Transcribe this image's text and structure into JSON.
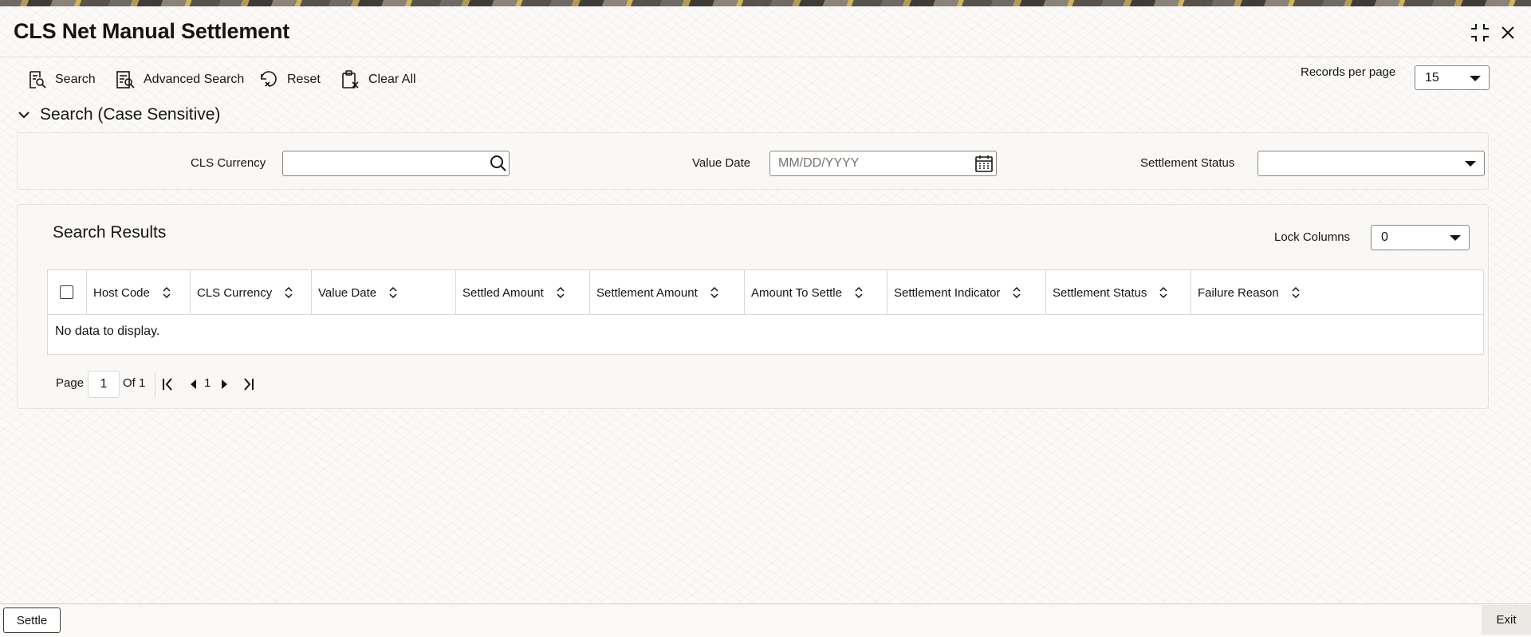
{
  "window": {
    "title": "CLS Net Manual Settlement"
  },
  "toolbar": {
    "search_label": "Search",
    "advanced_search_label": "Advanced Search",
    "reset_label": "Reset",
    "clear_all_label": "Clear All",
    "records_per_page_label": "Records per page",
    "records_per_page_value": "15"
  },
  "search_section": {
    "title": "Search (Case Sensitive)",
    "fields": {
      "cls_currency": {
        "label": "CLS Currency",
        "value": ""
      },
      "value_date": {
        "label": "Value Date",
        "placeholder": "MM/DD/YYYY",
        "value": ""
      },
      "settlement_status": {
        "label": "Settlement Status",
        "value": ""
      }
    }
  },
  "results": {
    "title": "Search Results",
    "lock_columns_label": "Lock Columns",
    "lock_columns_value": "0",
    "columns": [
      "Host Code",
      "CLS Currency",
      "Value Date",
      "Settled Amount",
      "Settlement Amount",
      "Amount To Settle",
      "Settlement Indicator",
      "Settlement Status",
      "Failure Reason"
    ],
    "rows": [],
    "empty_message": "No data to display."
  },
  "pagination": {
    "page_label": "Page",
    "current_page": "1",
    "of_label": "Of 1",
    "nav_page": "1"
  },
  "footer": {
    "settle_label": "Settle",
    "exit_label": "Exit"
  },
  "icons": {
    "collapse": "collapse-icon",
    "close": "close-icon",
    "search": "search-icon",
    "advanced_search": "advanced-search-icon",
    "reset": "reset-icon",
    "clear_all": "clear-all-icon",
    "calendar": "calendar-icon",
    "chevron": "chevron-down-icon",
    "sort": "sort-icon",
    "first_page": "first-page-icon",
    "previous_page": "previous-page-icon",
    "next_page": "next-page-icon",
    "last_page": "last-page-icon"
  }
}
